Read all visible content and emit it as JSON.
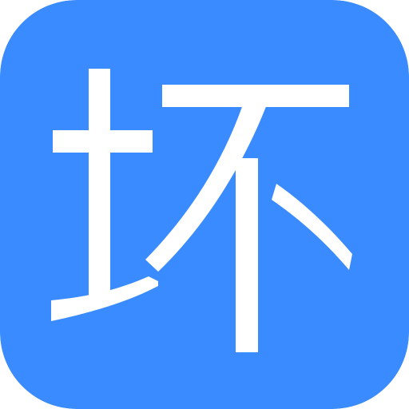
{
  "icon": {
    "glyph": "坏",
    "background_color": "#3A8BFF",
    "glyph_color": "#FFFFFF"
  }
}
